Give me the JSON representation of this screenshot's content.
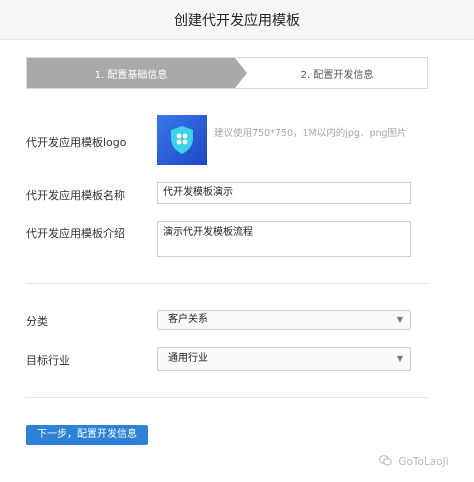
{
  "header": {
    "title": "创建代开发应用模板"
  },
  "steps": [
    {
      "label": "1. 配置基础信息",
      "active": true
    },
    {
      "label": "2. 配置开发信息",
      "active": false
    }
  ],
  "form": {
    "logo_label": "代开发应用模板logo",
    "logo_hint": "建议使用750*750，1M以内的jpg、png图片",
    "name_label": "代开发应用模板名称",
    "name_value": "代开发模板演示",
    "intro_label": "代开发应用模板介绍",
    "intro_value": "演示代开发模板流程",
    "category_label": "分类",
    "category_value": "客户关系",
    "industry_label": "目标行业",
    "industry_value": "通用行业"
  },
  "actions": {
    "next_label": "下一步，配置开发信息"
  },
  "watermark": {
    "text": "GoToLaoJi"
  },
  "colors": {
    "primary_button": "#2d82d7",
    "active_step": "#a9a9a9",
    "logo_blue": "#2a5bd7"
  }
}
